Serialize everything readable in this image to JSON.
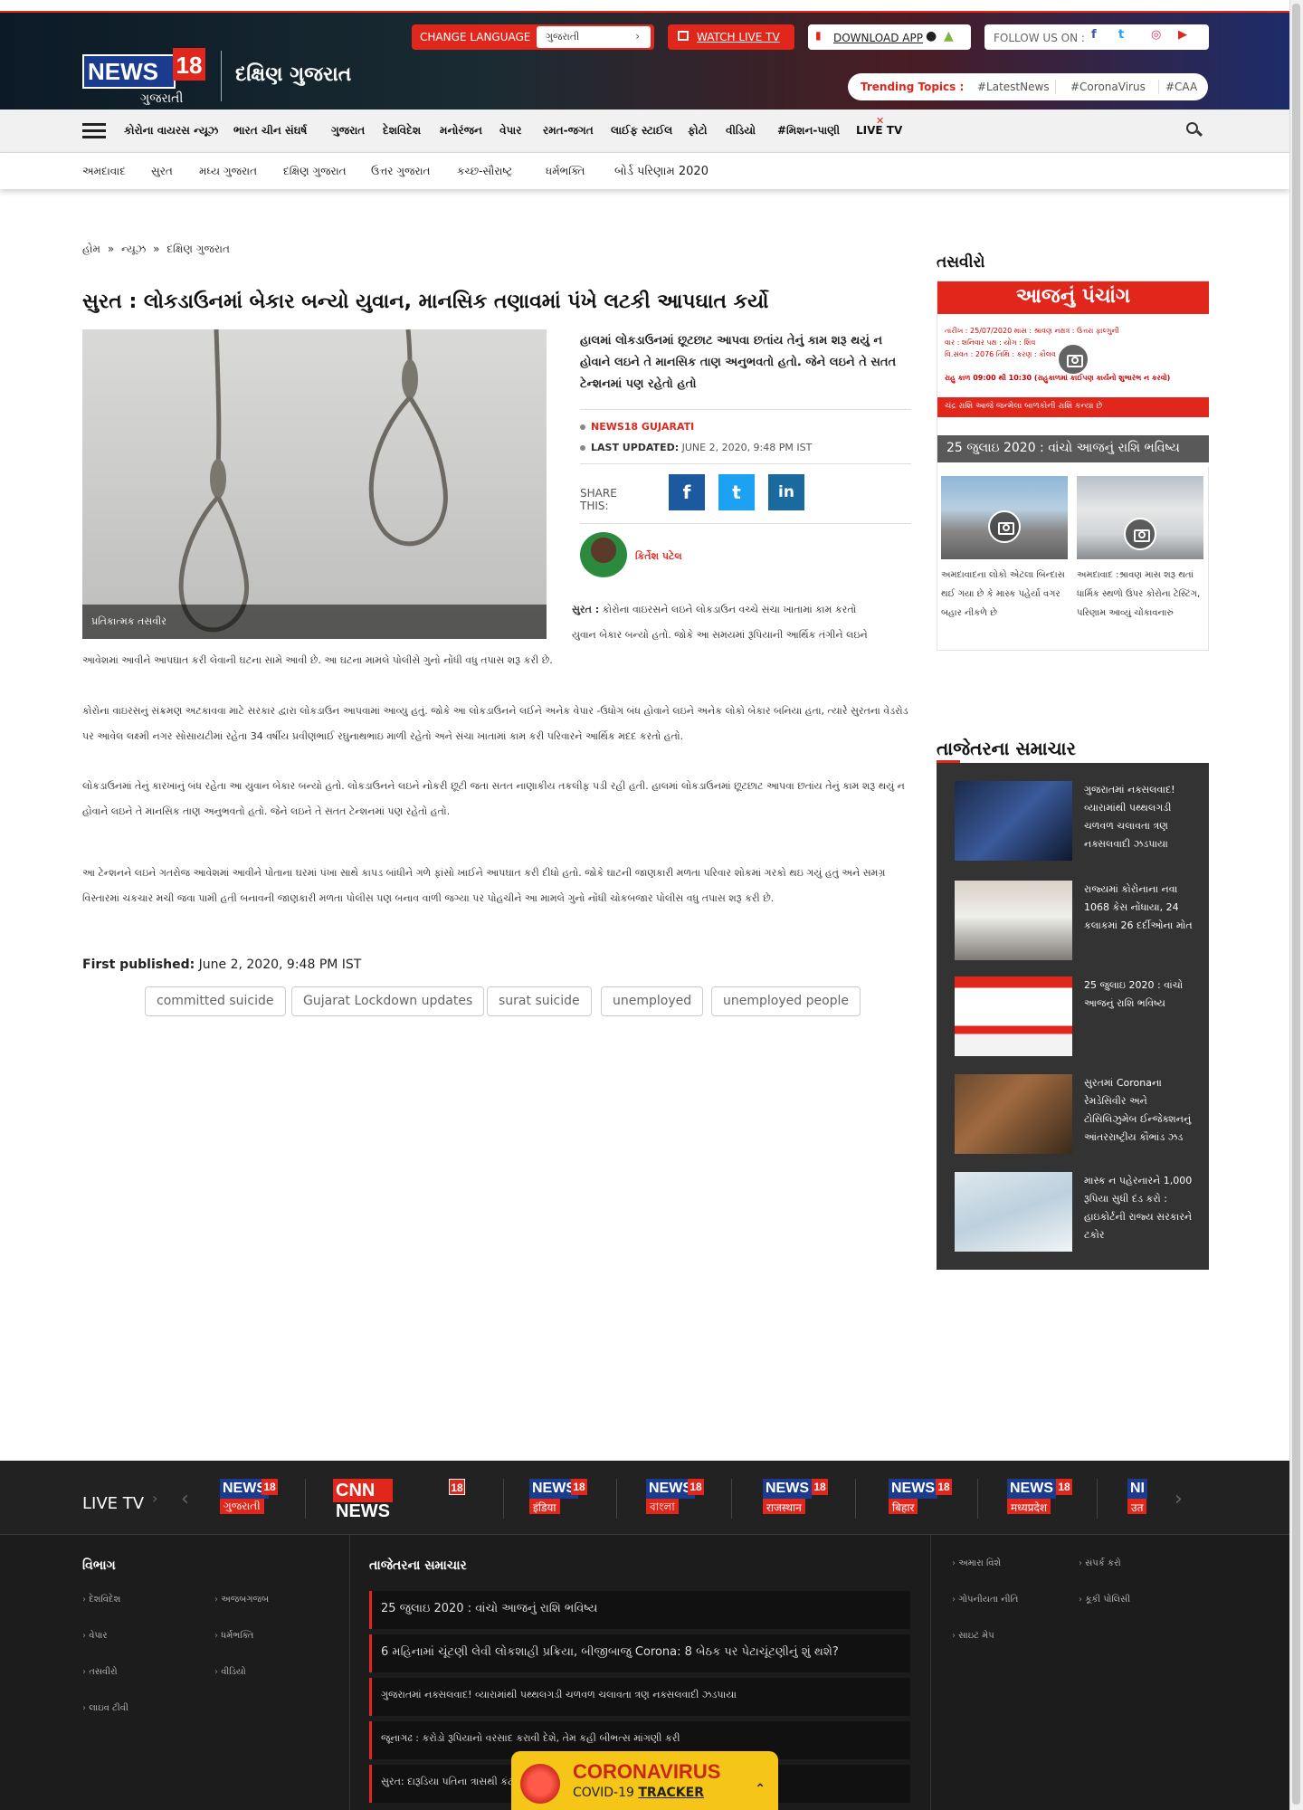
{
  "topbar": {
    "logo_text": "NEWS",
    "logo_num": "18",
    "logo_sub": "ગુજરાતી",
    "section": "દક્ષિણ ગુજરાત",
    "change_language": "CHANGE LANGUAGE",
    "language_value": "ગુજરાતી",
    "watch_live": "WATCH LIVE TV",
    "download_app": "DOWNLOAD APP",
    "follow_us": "FOLLOW US ON :",
    "trending_label": "Trending Topics :",
    "trending": [
      "#LatestNews",
      "#CoronaVirus",
      "#CAA"
    ]
  },
  "nav": {
    "items": [
      "કોરોના વાયરસ ન્યૂઝ",
      "ભારત ચીન સંઘર્ષ",
      "ગુજરાત",
      "દેશવિદેશ",
      "મનોરંજન",
      "વેપાર",
      "રમત-જગત",
      "લાઈફ સ્ટાઈલ",
      "ફોટો",
      "વીડિયો",
      "#મિશન-પાણી",
      "LIVE TV"
    ],
    "sub_items": [
      "અમદાવાદ",
      "સુરત",
      "મધ્ય ગુજરાત",
      "દક્ષિણ ગુજરાત",
      "ઉત્તર ગુજરાત",
      "કચ્છ-સૌરાષ્ટ્ર",
      "ધર્મભક્તિ",
      "બોર્ડ પરિણામ 2020"
    ]
  },
  "breadcrumb": {
    "home": "હોમ",
    "sep": "»",
    "news": "ન્યૂઝ",
    "current": "દક્ષિણ ગુજરાત"
  },
  "article": {
    "headline": "સુરત : લોકડાઉનમાં બેકાર બન્યો યુવાન, માનસિક તણાવમાં પંખે લટકી આપઘાત કર્યો",
    "image_caption": "પ્રતિકાત્મક તસવીર",
    "summary": "હાલમાં લોકડાઉનમાં છૂટછાટ આપવા છતાંય તેનું કામ શરૂ થયું ન હોવાને લઇને તે માનસિક તાણ અનુભવતો હતો. જેને લઇને તે સતત ટેન્શનમાં પણ રહેતો હતો",
    "source": "NEWS18 GUJARATI",
    "last_updated_label": "LAST UPDATED:",
    "last_updated": "JUNE 2, 2020, 9:48 PM IST",
    "share_label": "SHARE THIS:",
    "author": "કિર્તેશ પટેલ",
    "p1_lead": "સુરત :",
    "p1a": "કોરોના વાઇરસને લઇને લોકડાઉન વચ્ચે સંચા ખાતામાં કામ કરતો",
    "p1b": "યુવાન બેકાર બન્યો હતો. જોકે આ સમયમાં રૂપિયાની આર્થિક તંગીને લઇને",
    "p1c": "આવેશમાં આવીને આપઘાત કરી લેવાની ઘટના સામે આવી છે. આ ઘટના મામલે પોલીસે ગુનો નોંધી વધુ તપાસ શરૂ કરી છે.",
    "p2": "કોરોના વાઇરસનું સંક્રમણ અટકાવવા માટે સરકાર દ્વારા લોકડાઉન આપવામાં આવ્યુ હતું. જોકે આ લોકડાઉનને લઈને અનેક વેપાર -ઉધોગ બંધ હોવાને લઇને અનેક લોકો બેકાર બનિયા હતા, ત્યારે સુરતના વેડરોડ પર આવેલ લક્ષ્મી નગર સોસાયટીમાં રહેતા 34 વર્ષીય પ્રવીણભાઈ રઘુનાથભાઇ માળી રહેતો અને સંચા ખાતામાં કામ કરી પરિવારને આર્થિક મદદ કરતો હતો.",
    "p3": "લોકડાઉનમાં તેનું કારખાનું બંધ રહેતા આ યુવાન બેકાર બન્યો હતો. લોકડાઉનને લઇને નોકરી છૂટી જતા સતત નાણાકીય તકલીફ પડી રહી હતી. હાલમાં લોકડાઉનમાં છૂટછાટ આપવા છતાંય તેનું કામ શરૂ થયું ન હોવાને લઇને તે માનસિક તાણ અનુભવતો હતો. જેને લઇને તે સતત ટેન્શનમાં પણ રહેતો હતો.",
    "p4": "આ ટેન્શનને લઇને ગતરોજ આવેશમાં આવીને પોતાના ઘરમાં પંખા સાથે કાપડ બાંધીને ગળે ફાંસો ખાઈને આપઘાત કરી દીધો હતો. જોકે ઘાટની જાણકારી મળતા પરિવાર શોકમાં ગરકો થઇ ગયું હતું અને સમગ્ર વિસ્તારમાં ચકચાર મચી જવા પામી હતી બનાવની જાણકારી મળતા પોલીસ પણ બનાવ વાળી જગ્યા પર પોહચીને આ મામલે ગુનો નોંધી ચોકબજાર પોલીસ વધુ તપાસ શરૂ કરી છે.",
    "first_published_label": "First published:",
    "first_published": "June 2, 2020, 9:48 PM IST",
    "tags": [
      "committed suicide",
      "Gujarat Lockdown updates",
      "surat suicide",
      "unemployed",
      "unemployed people"
    ]
  },
  "sidebar": {
    "photos_title": "તસવીરો",
    "panchang_title": "આજનું પંચાંગ",
    "panchang_line1": "તારીખ : 25/07/2020   માસ : શ્રાવણ   નક્ષત્ર : ઉત્તરા ફાલ્ગુની",
    "panchang_line2": "વાર : શનિવાર   પક્ષ :   યોગ : શિવ",
    "panchang_line3": "વિ.સંવત : 2076   તિથિ :   કરણ : કૌલવ",
    "rahu_kaal": "રાહુ કાળ     09:00 થી 10:30 (રાહુકાળમાં કોઈપણ કાર્યનો શુભારંભ ન કરવો)",
    "chandra_rashi": "ચંદ્ર રાશિ     આજે જન્મેલા બાળકોની રાશિ કન્યા છે",
    "photo_caption": "25 જુલાઇ 2020 : વાંચો આજનું રાશિ ભવિષ્ય",
    "small1_caption": "અમદાવાદના લોકો એટલા બિન્દાસ થઈ ગયા છે કે માસ્ક પહેર્યા વગર બહાર નીકળે છે",
    "small2_caption": "અમદાવાદ :શ્રાવણ માસ શરૂ થતાં ધાર્મિક સ્થળો ઉપર કોરોના ટેસ્ટિંગ, પરિણામ આવ્યું ચોંકાવનારું",
    "latest_title": "તાજેતરના સમાચાર",
    "latest": [
      "ગુજરાતમાં નક્સલવાદ! વ્યારામાંથી પથ્થલગડી ચળવળ ચલાવતા ત્રણ નક્સલવાદી ઝડપાયા",
      "રાજ્યમાં કોરોનાના નવા 1068 કેસ નોંધાયા, 24 કલાકમાં 26 દર્દીઓના મોત",
      "25 જુલાઇ 2020 : વાંચો આજનું રાશિ ભવિષ્ય",
      "સુરતમાં Coronaના રેમડેસિવીર અને ટોસિલિઝુમેબ ઈન્જેક્શનનું આંતરરાષ્ટ્રીય કૌભાંડ ઝડ",
      "માસ્ક ન પહેરનારને 1,000 રૂપિયા સુધી દંડ કરો : હાઇકોર્ટની રાજ્ય સરકારને ટકોર"
    ]
  },
  "footer": {
    "live_tv": "LIVE TV",
    "channels": [
      {
        "name": "NEWS",
        "num": "18",
        "label": "ગુજરાતી"
      },
      {
        "name": "CNN NEWS",
        "num": "18",
        "label": ""
      },
      {
        "name": "NEWS",
        "num": "18",
        "label": "इंडिया"
      },
      {
        "name": "NEWS",
        "num": "18",
        "label": "বাংলা"
      },
      {
        "name": "NEWS",
        "num": "18",
        "label": "राजस्थान"
      },
      {
        "name": "NEWS",
        "num": "18",
        "label": "बिहार"
      },
      {
        "name": "NEWS",
        "num": "18",
        "label": "मध्यप्रदेश"
      },
      {
        "name": "NI",
        "num": "",
        "label": "उत"
      }
    ],
    "vibhag_title": "વિભાગ",
    "vibhag": [
      "દેશવિદેશ",
      "અજબગજબ",
      "વેપાર",
      "ધર્મભક્તિ",
      "તસવીરો",
      "વીડિયો",
      "લાઇવ ટીવી"
    ],
    "latest_title": "તાજેતરના સમાચાર",
    "latest": [
      "25 જુલાઇ 2020 : વાંચો આજનું રાશિ ભવિષ્ય",
      "6 મહિનામાં ચૂંટણી લેવી લોકશાહી પ્રક્રિયા, બીજીબાજુ Corona: 8 બેઠક પર પેટાચૂંટણીનું શું થશે?",
      "ગુજરાતમાં નક્સલવાદ! વ્યારામાંથી પથ્થલગડી ચળવળ ચલાવતા ત્રણ નક્સલવાદી ઝડપાયા",
      "જૂનાગઢ : કરોડો રૂપિયાનો વરસાદ કરાવી દેશે, તેમ કહી બીભત્સ માંગણી કરી",
      "સુરત: દારૂડિયા પતિના ત્રાસથી કંટાળેલી પત્નીએ ભર્યું અંતિમ પગલું, પોલીસ ચોકી જશો"
    ],
    "links": [
      "અમારા વિશે",
      "સંપર્ક કરો",
      "ગોપનીયતા નીતિ",
      "કૂકી પોલિસી",
      "સાઇટ મેપ"
    ],
    "covid_title": "CORONAVIRUS",
    "covid_sub": "COVID-19",
    "covid_tracker": "TRACKER"
  }
}
